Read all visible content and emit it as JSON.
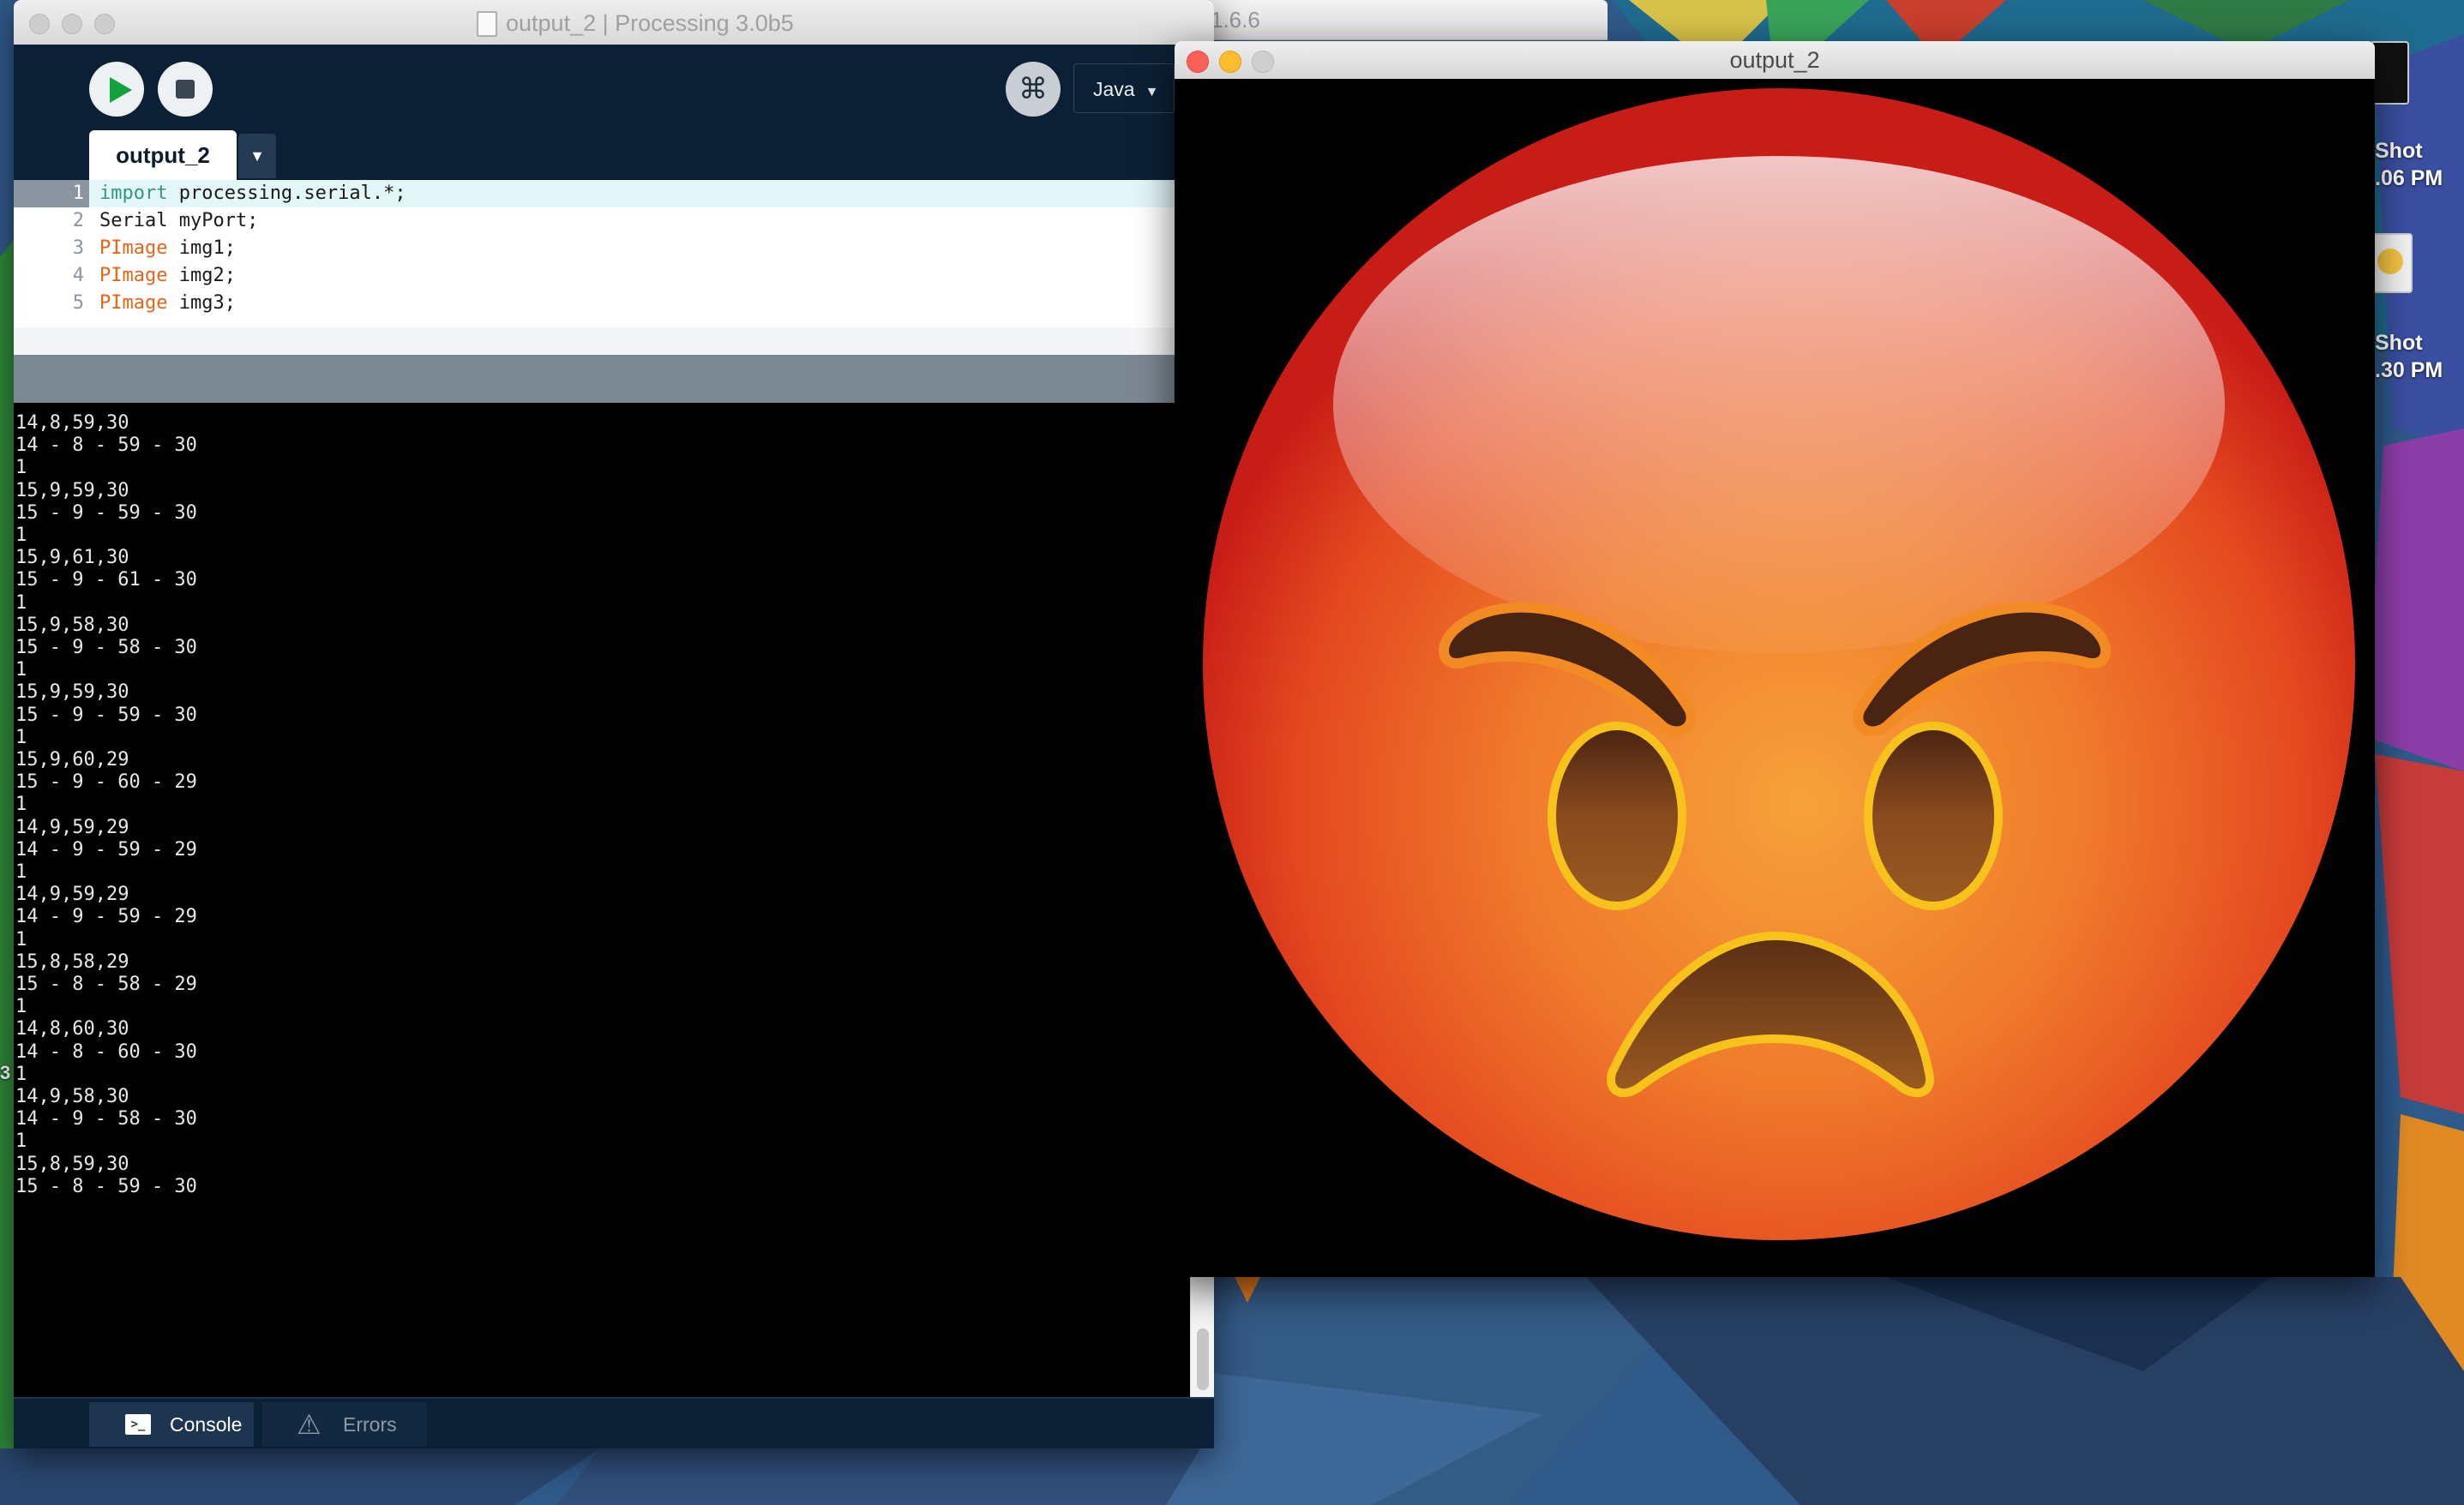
{
  "desktop": {
    "file1_label": "Shot\n.06 PM",
    "file2_label": "Shot\n.30 PM",
    "background_window_title": "1.6.6",
    "edge_number": "3"
  },
  "ide": {
    "window_title": "output_2 | Processing 3.0b5",
    "toolbar": {
      "run_icon": "play-icon",
      "stop_icon": "stop-icon",
      "debug_icon": "debugger-icon",
      "mode": "Java"
    },
    "tab": {
      "label": "output_2",
      "menu_icon": "dropdown-arrow"
    },
    "code_lines": [
      {
        "num": "1",
        "tokens": [
          {
            "text": "import",
            "kind": "import"
          },
          {
            "text": " processing.serial.*;",
            "kind": "plain"
          }
        ]
      },
      {
        "num": "2",
        "tokens": [
          {
            "text": "Serial myPort;",
            "kind": "plain"
          }
        ]
      },
      {
        "num": "3",
        "tokens": [
          {
            "text": "PImage",
            "kind": "type"
          },
          {
            "text": " img1;",
            "kind": "plain"
          }
        ]
      },
      {
        "num": "4",
        "tokens": [
          {
            "text": "PImage",
            "kind": "type"
          },
          {
            "text": " img2;",
            "kind": "plain"
          }
        ]
      },
      {
        "num": "5",
        "tokens": [
          {
            "text": "PImage",
            "kind": "type"
          },
          {
            "text": " img3;",
            "kind": "plain"
          }
        ]
      }
    ],
    "console_lines": [
      "14,8,59,30",
      "14 - 8 - 59 - 30",
      "1",
      "15,9,59,30",
      "15 - 9 - 59 - 30",
      "1",
      "15,9,61,30",
      "15 - 9 - 61 - 30",
      "1",
      "15,9,58,30",
      "15 - 9 - 58 - 30",
      "1",
      "15,9,59,30",
      "15 - 9 - 59 - 30",
      "1",
      "15,9,60,29",
      "15 - 9 - 60 - 29",
      "1",
      "14,9,59,29",
      "14 - 9 - 59 - 29",
      "1",
      "14,9,59,29",
      "14 - 9 - 59 - 29",
      "1",
      "15,8,58,29",
      "15 - 8 - 58 - 29",
      "1",
      "14,8,60,30",
      "14 - 8 - 60 - 30",
      "1",
      "14,9,58,30",
      "14 - 9 - 58 - 30",
      "1",
      "15,8,59,30",
      "15 - 8 - 59 - 30"
    ],
    "footer": {
      "console_label": "Console",
      "errors_label": "Errors"
    }
  },
  "sketch_window": {
    "title": "output_2",
    "image": "angry-face-emoji"
  },
  "colors": {
    "ide_background": "#0c2035",
    "keyword_import": "#33997e",
    "keyword_type": "#e2661a",
    "run_green": "#11a33b",
    "emoji_red": "#d2251d",
    "emoji_orange": "#f3922e"
  }
}
